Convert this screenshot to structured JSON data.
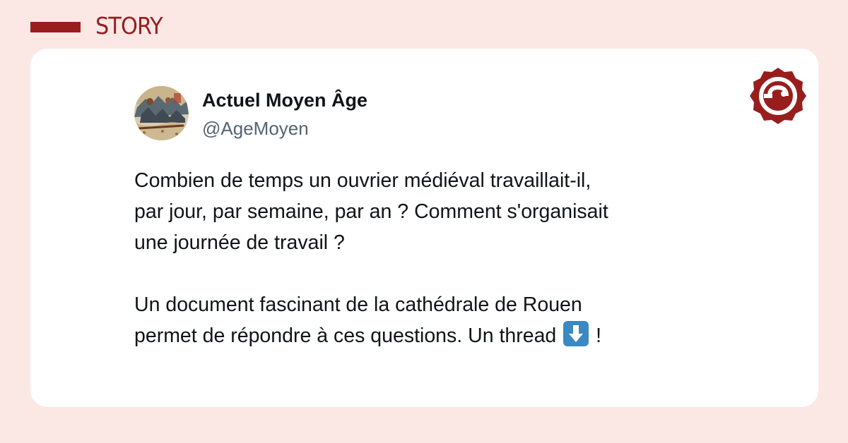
{
  "header": {
    "section_label": "STORY"
  },
  "tweet": {
    "display_name": "Actuel Moyen Âge",
    "handle": "@AgeMoyen",
    "paragraph1": {
      "line1": "Combien de temps un ouvrier médiéval travaillait-il,",
      "line2": "par jour, par semaine, par an ? Comment s'organisait",
      "line3": "une journée de travail ?"
    },
    "paragraph2": {
      "line1": "Un document fascinant de la cathédrale de Rouen",
      "line2_before_emoji": "permet de répondre à ces questions. Un thread ",
      "line2_after_emoji": " !"
    }
  },
  "icons": {
    "brand_logo": "seal-logo-icon",
    "emoji": "down-arrow-emoji-icon"
  },
  "colors": {
    "accent": "#981e1e",
    "background": "#fbe8e5",
    "card": "#ffffff",
    "text": "#0f1419",
    "muted": "#536471",
    "emoji_blue": "#3b88c3"
  }
}
